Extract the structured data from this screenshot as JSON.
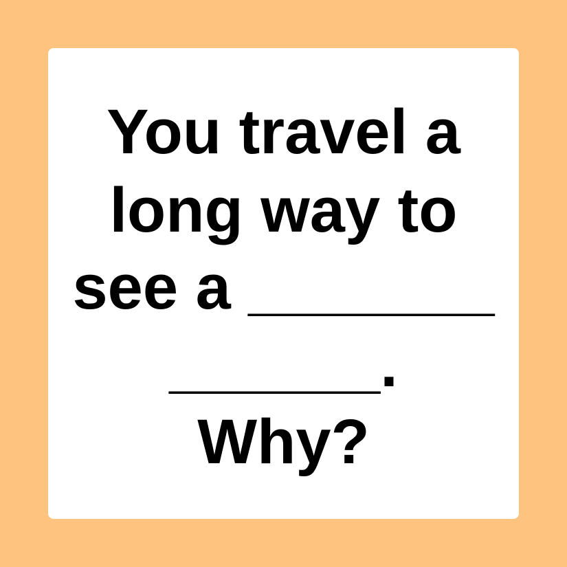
{
  "colors": {
    "background": "#FEC47F",
    "card": "#FFFFFF",
    "text": "#000000"
  },
  "prompt": {
    "lines": [
      "You travel a",
      "long way to",
      "see a _______",
      "______.",
      "Why?"
    ]
  }
}
